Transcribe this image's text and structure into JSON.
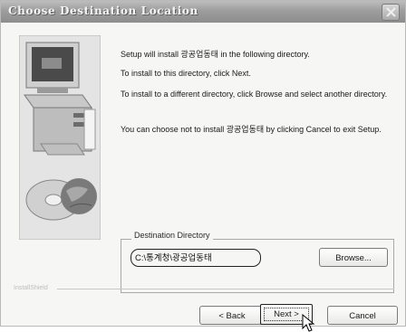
{
  "window": {
    "title": "Choose Destination Location"
  },
  "messages": {
    "line1": "Setup will install 광공업동태 in the following directory.",
    "line2": "To install to this directory, click Next.",
    "line3": "To install to a different directory, click Browse and select another directory.",
    "line4": "You can choose not to install 광공업동태 by clicking Cancel to exit Setup."
  },
  "destination": {
    "group_label": "Destination Directory",
    "path": "C:\\통계청\\광공업동태"
  },
  "buttons": {
    "browse": "Browse...",
    "back": "< Back",
    "next": "Next >",
    "cancel": "Cancel"
  },
  "footer": {
    "brand": "InstallShield"
  },
  "colors": {
    "titlebar": "#9d9d9d",
    "dialog": "#f6f6f4"
  }
}
